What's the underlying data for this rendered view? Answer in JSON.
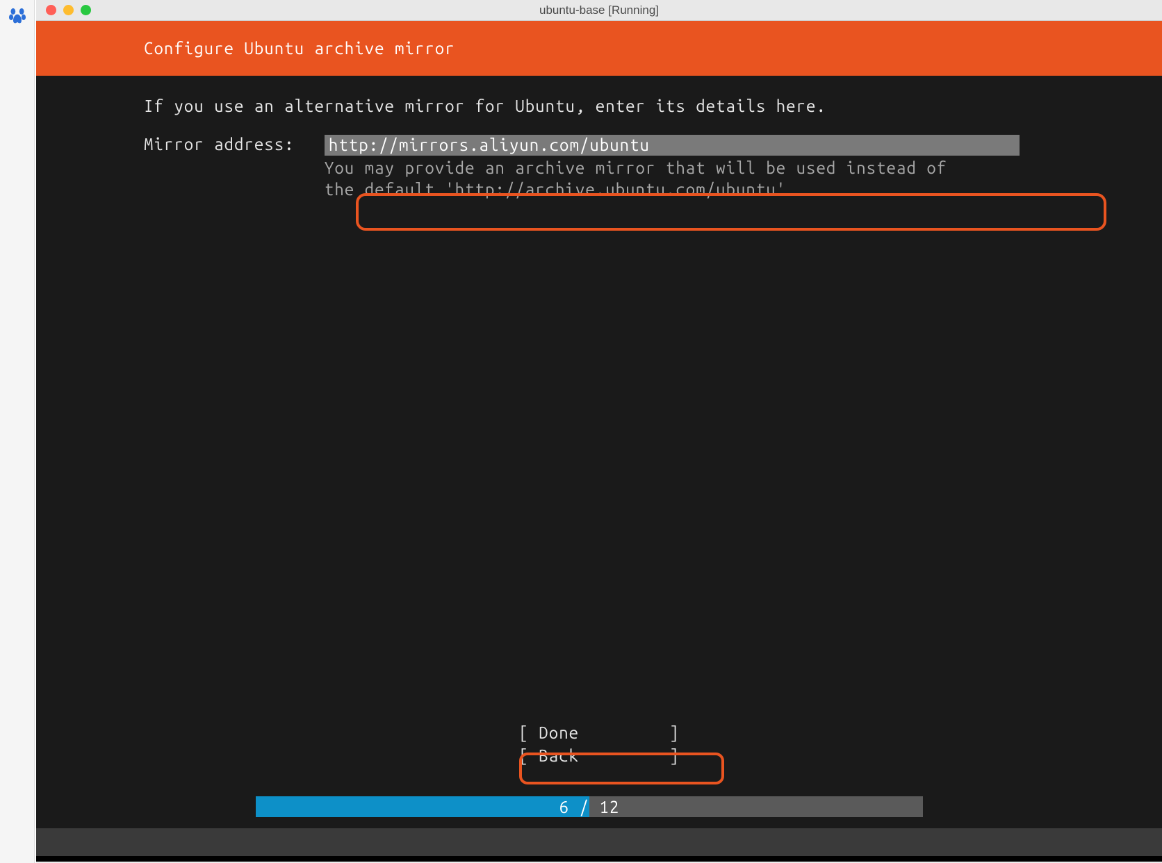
{
  "sidebar": {
    "icon_name": "baidu-paw-icon"
  },
  "titlebar": {
    "title": "ubuntu-base [Running]"
  },
  "installer": {
    "header": "Configure Ubuntu archive mirror",
    "instruction": "If you use an alternative mirror for Ubuntu, enter its details here.",
    "field_label": "Mirror address:   ",
    "mirror_value": "http://mirrors.aliyun.com/ubuntu",
    "hint_line1": "You may provide an archive mirror that will be used instead of",
    "hint_line2": "the default 'http://archive.ubuntu.com/ubuntu'",
    "buttons": {
      "done": "[ Done         ]",
      "back": "[ Back         ]"
    },
    "progress": {
      "current": 6,
      "total": 12,
      "label": "6 / 12"
    }
  }
}
